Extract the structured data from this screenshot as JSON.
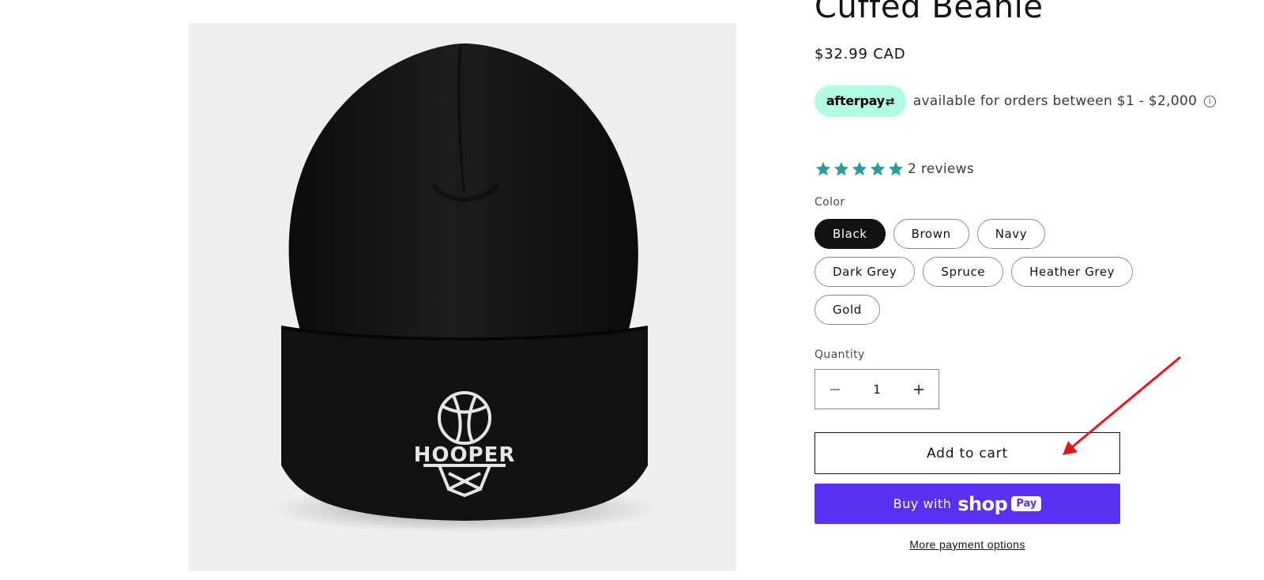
{
  "product": {
    "title": "Cuffed Beanie",
    "price": "$32.99 CAD",
    "image_alt": "Black cuffed beanie with embroidered HOOPER basketball logo",
    "logo_text": "HOOPER"
  },
  "afterpay": {
    "badge_label": "afterpay",
    "text": "available for orders between $1 - $2,000",
    "info_icon": "info-icon"
  },
  "reviews": {
    "rating": 5,
    "max": 5,
    "count_label": "2 reviews",
    "star_color": "#2a9d9b"
  },
  "color_option": {
    "label": "Color",
    "options": [
      "Black",
      "Brown",
      "Navy",
      "Dark Grey",
      "Spruce",
      "Heather Grey",
      "Gold"
    ],
    "selected": "Black"
  },
  "quantity": {
    "label": "Quantity",
    "value": "1",
    "minus_icon": "minus-icon",
    "plus_icon": "plus-icon"
  },
  "buttons": {
    "add_to_cart": "Add to cart",
    "buy_with": "Buy with",
    "shop_word": "shop",
    "pay_pill": "Pay",
    "more_payment": "More payment options"
  },
  "colors": {
    "shop_pay": "#5a31f4",
    "afterpay_badge": "#b2fce4",
    "annotation_arrow": "#e8141c"
  }
}
